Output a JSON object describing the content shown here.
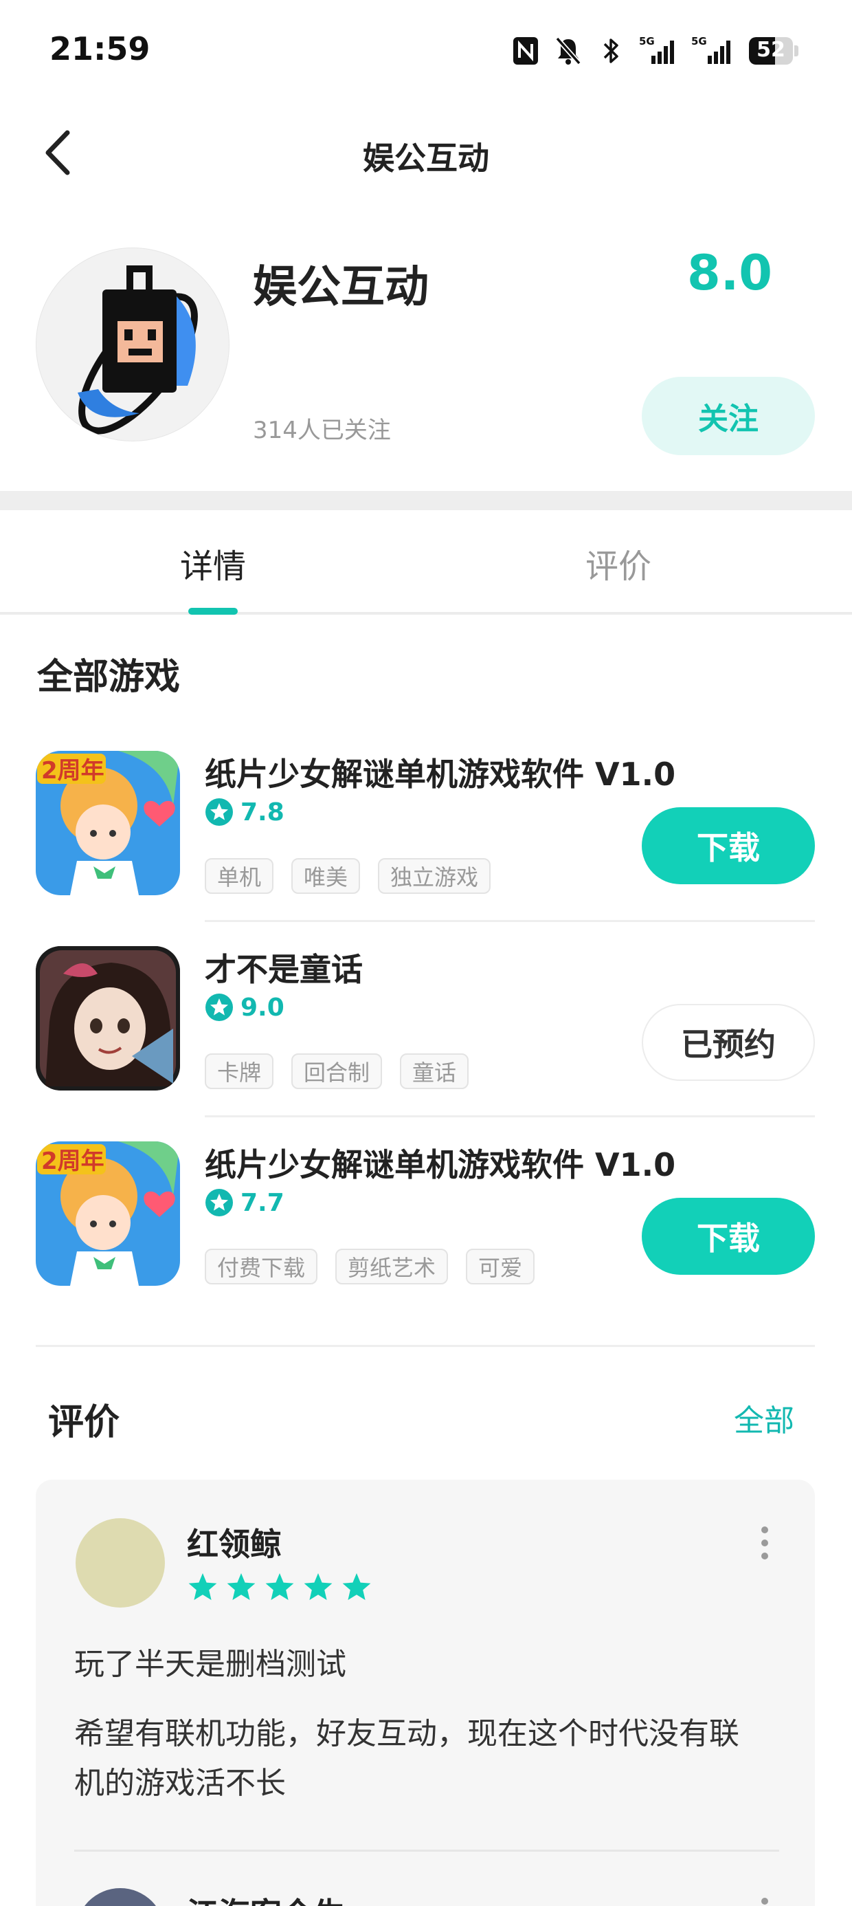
{
  "status_bar": {
    "time": "21:59",
    "battery_level": "52",
    "icons": [
      "nfc-icon",
      "silent-bell-icon",
      "bluetooth-icon",
      "signal-5g-icon",
      "signal-5g-icon",
      "battery-icon"
    ],
    "signal_label_1": "5G",
    "signal_label_2": "5G"
  },
  "nav": {
    "title": "娱公互动",
    "back_icon": "chevron-left-icon"
  },
  "developer": {
    "name": "娱公互动",
    "score": "8.0",
    "followers": "314人已关注",
    "follow_label": "关注"
  },
  "tabs": [
    {
      "label": "详情",
      "active": true
    },
    {
      "label": "评价",
      "active": false
    }
  ],
  "games_section": {
    "title": "全部游戏",
    "games": [
      {
        "title": "纸片少女解谜单机游戏软件 V1.0",
        "rating": "7.8",
        "tags": [
          "单机",
          "唯美",
          "独立游戏"
        ],
        "action": "下载",
        "icon_badge": "2周年"
      },
      {
        "title": "才不是童话",
        "rating": "9.0",
        "tags": [
          "卡牌",
          "回合制",
          "童话"
        ],
        "action": "已预约"
      },
      {
        "title": "纸片少女解谜单机游戏软件 V1.0",
        "rating": "7.7",
        "tags": [
          "付费下载",
          "剪纸艺术",
          "可爱"
        ],
        "action": "下载",
        "icon_badge": "2周年"
      }
    ]
  },
  "reviews": {
    "title": "评价",
    "all_label": "全部",
    "items": [
      {
        "name": "红领鲸",
        "stars": 5,
        "line1": "玩了半天是删档测试",
        "body": "希望有联机功能，好友互动，现在这个时代没有联机的游戏活不长"
      },
      {
        "name": "江海客今生"
      }
    ]
  },
  "colors": {
    "accent": "#12c4b0",
    "button": "#12d0b8",
    "follow_bg": "#e2f8f5",
    "avatar_reviewer": "#dedbb0"
  }
}
